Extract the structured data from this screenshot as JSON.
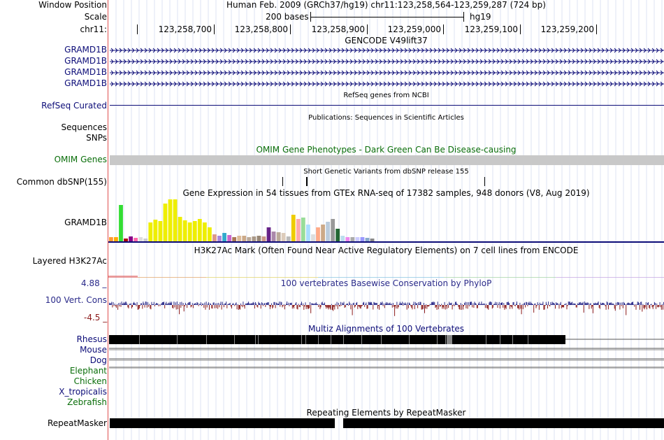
{
  "header": {
    "window_position_label": "Window Position",
    "window_position_text": "Human Feb. 2009 (GRCh37/hg19)   chr11:123,258,564-123,259,287 (724 bp)",
    "scale_label": "Scale",
    "scale_bar_text": "200 bases",
    "scale_assembly": "hg19",
    "chrom_label": "chr11:",
    "ruler_ticks": [
      "123,258,700",
      "123,258,800",
      "123,258,900",
      "123,259,000",
      "123,259,100",
      "123,259,200"
    ]
  },
  "tracks": {
    "gencode": {
      "title": "GENCODE V49lift37",
      "rows": [
        "GRAMD1B",
        "GRAMD1B",
        "GRAMD1B",
        "GRAMD1B"
      ],
      "color": "#0c0c78"
    },
    "refseq": {
      "title": "RefSeq genes from NCBI",
      "label": "RefSeq Curated",
      "color": "#0c0c78"
    },
    "publications": {
      "title": "Publications: Sequences in Scientific Articles",
      "labels": [
        "Sequences",
        "SNPs"
      ]
    },
    "omim": {
      "title": "OMIM Gene Phenotypes - Dark Green Can Be Disease-causing",
      "label": "OMIM Genes",
      "color": "#0a6e0a",
      "bar_color": "#c8c8c8"
    },
    "dbsnp": {
      "title": "Short Genetic Variants from dbSNP release 155",
      "label": "Common dbSNP(155)"
    },
    "gtex": {
      "title": "Gene Expression in 54 tissues from GTEx RNA-seq of 17382 samples, 948 donors (V8, Aug 2019)",
      "label": "GRAMD1B"
    },
    "h3k27ac": {
      "title": "H3K27Ac Mark (Often Found Near Active Regulatory Elements) on 7 cell lines from ENCODE",
      "label": "Layered H3K27Ac"
    },
    "phylop": {
      "title": "100 vertebrates Basewise Conservation by PhyloP",
      "label": "100 Vert. Cons",
      "max": "4.88 _",
      "min": "-4.5 _",
      "color": "#2b2b8a",
      "neg_color": "#8b1a1a"
    },
    "multiz": {
      "title": "Multiz Alignments of 100 Vertebrates",
      "species": [
        {
          "name": "Rhesus",
          "color": "#0c0c78"
        },
        {
          "name": "Mouse",
          "color": "#0c0c78"
        },
        {
          "name": "Dog",
          "color": "#0c0c78"
        },
        {
          "name": "Elephant",
          "color": "#0a6e0a"
        },
        {
          "name": "Chicken",
          "color": "#0a6e0a"
        },
        {
          "name": "X_tropicalis",
          "color": "#0c0c78"
        },
        {
          "name": "Zebrafish",
          "color": "#0a6e0a"
        }
      ]
    },
    "repeatmasker": {
      "title": "Repeating Elements by RepeatMasker",
      "label": "RepeatMasker"
    }
  }
}
